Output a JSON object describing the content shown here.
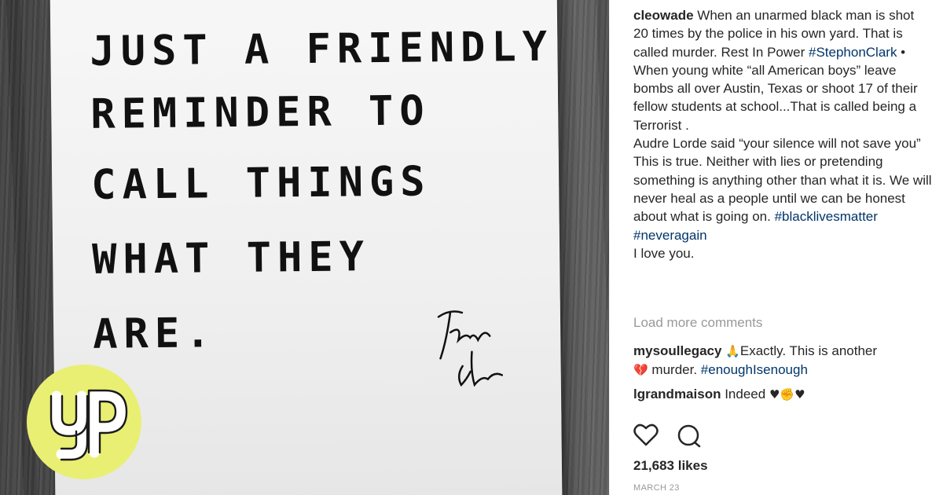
{
  "note": {
    "lines": [
      "JUST A FRIENDLY",
      "REMINDER TO",
      "CALL THINGS",
      "WHAT THEY",
      "ARE."
    ]
  },
  "post": {
    "username": "cleowade",
    "caption_segments": [
      {
        "type": "text",
        "value": "When an unarmed black man is shot 20 times by the police in his own yard. That is called murder. Rest In Power "
      },
      {
        "type": "tag",
        "value": "#StephonClark"
      },
      {
        "type": "text",
        "value": " •"
      },
      {
        "type": "br"
      },
      {
        "type": "text",
        "value": "When young white “all American boys” leave bombs all over Austin, Texas or shoot 17 of their fellow students at school...That is called being a Terrorist ."
      },
      {
        "type": "br"
      },
      {
        "type": "text",
        "value": "Audre Lorde said “your silence will not save you” This is true. Neither with lies or pretending something is anything other than what it is. We will never heal as a people until we can be honest about what is going on. "
      },
      {
        "type": "tag",
        "value": "#blacklivesmatter"
      },
      {
        "type": "text",
        "value": " "
      },
      {
        "type": "tag",
        "value": "#neveragain"
      },
      {
        "type": "br"
      },
      {
        "type": "text",
        "value": "I love you."
      }
    ],
    "load_more": "Load more comments",
    "comments": [
      {
        "username": "mysoullegacy",
        "emoji1": "🙏",
        "text1": "Exactly. This is another",
        "emoji2": "💔",
        "text2": "murder. ",
        "tag": "#enoughIsenough"
      },
      {
        "username": "lgrandmaison",
        "text": "Indeed ",
        "emoji": [
          "♥",
          "✊",
          "♥"
        ]
      }
    ],
    "likes": "21,683 likes",
    "date": "MARCH 23",
    "icons": [
      "heart-icon",
      "comment-icon"
    ]
  },
  "colors": {
    "hashtag": "#003569",
    "text": "#262626",
    "muted": "#999999",
    "logo_bg": "#e9ef73"
  }
}
